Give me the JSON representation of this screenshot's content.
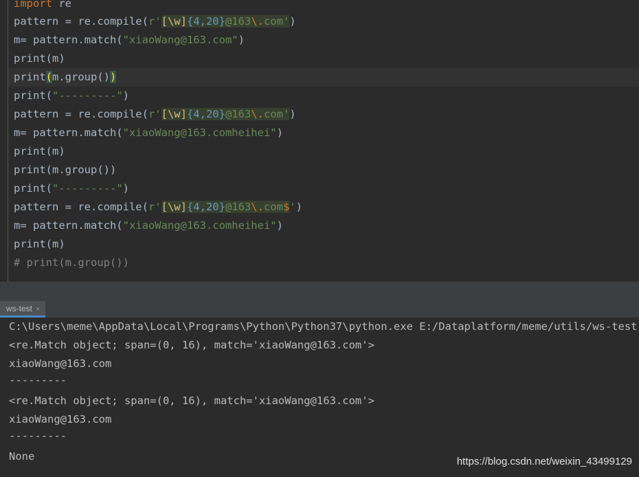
{
  "editor": {
    "l1_import": "import",
    "l1_mod": " re",
    "l2_a": "pattern = re.compile(",
    "l2_pre": "r'",
    "l2_cls": "[\\w]",
    "l2_q": "{4,20}",
    "l2_lit": "@163",
    "l2_esc": "\\.",
    "l2_tail": "com'",
    "l2_close": ")",
    "l3_a": "m= pattern.match(",
    "l3_str": "\"xiaoWang@163.com\"",
    "l3_close": ")",
    "l4": "print(m)",
    "l5_fn": "print",
    "l5_open": "(",
    "l5_mid": "m.group()",
    "l5_close": ")",
    "l6_a": "print(",
    "l6_str": "\"---------\"",
    "l6_close": ")",
    "l7_a": "pattern = re.compile(",
    "l7_pre": "r'",
    "l7_cls": "[\\w]",
    "l7_q": "{4,20}",
    "l7_lit": "@163",
    "l7_esc": "\\.",
    "l7_tail": "com'",
    "l7_close": ")",
    "l8_a": "m= pattern.match(",
    "l8_str": "\"xiaoWang@163.comheihei\"",
    "l8_close": ")",
    "l9": "print(m)",
    "l10": "print(m.group())",
    "l11_a": "print(",
    "l11_str": "\"---------\"",
    "l11_close": ")",
    "l12_a": "pattern = re.compile(",
    "l12_pre": "r'",
    "l12_cls": "[\\w]",
    "l12_q": "{4,20}",
    "l12_lit": "@163",
    "l12_esc": "\\.",
    "l12_tail": "com",
    "l12_dollar": "$",
    "l12_quote": "'",
    "l12_close": ")",
    "l13_a": "m= pattern.match(",
    "l13_str": "\"xiaoWang@163.comheihei\"",
    "l13_close": ")",
    "l14": "print(m)",
    "l15": "# print(m.group())"
  },
  "run_panel": {
    "tab_label": "ws-test",
    "tab_close": "×"
  },
  "console": {
    "lines": [
      "C:\\Users\\meme\\AppData\\Local\\Programs\\Python\\Python37\\python.exe E:/Dataplatform/meme/utils/ws-test.py",
      "<re.Match object; span=(0, 16), match='xiaoWang@163.com'>",
      "xiaoWang@163.com",
      "---------",
      "<re.Match object; span=(0, 16), match='xiaoWang@163.com'>",
      "xiaoWang@163.com",
      "---------",
      "None"
    ]
  },
  "watermark": "https://blog.csdn.net/weixin_43499129"
}
